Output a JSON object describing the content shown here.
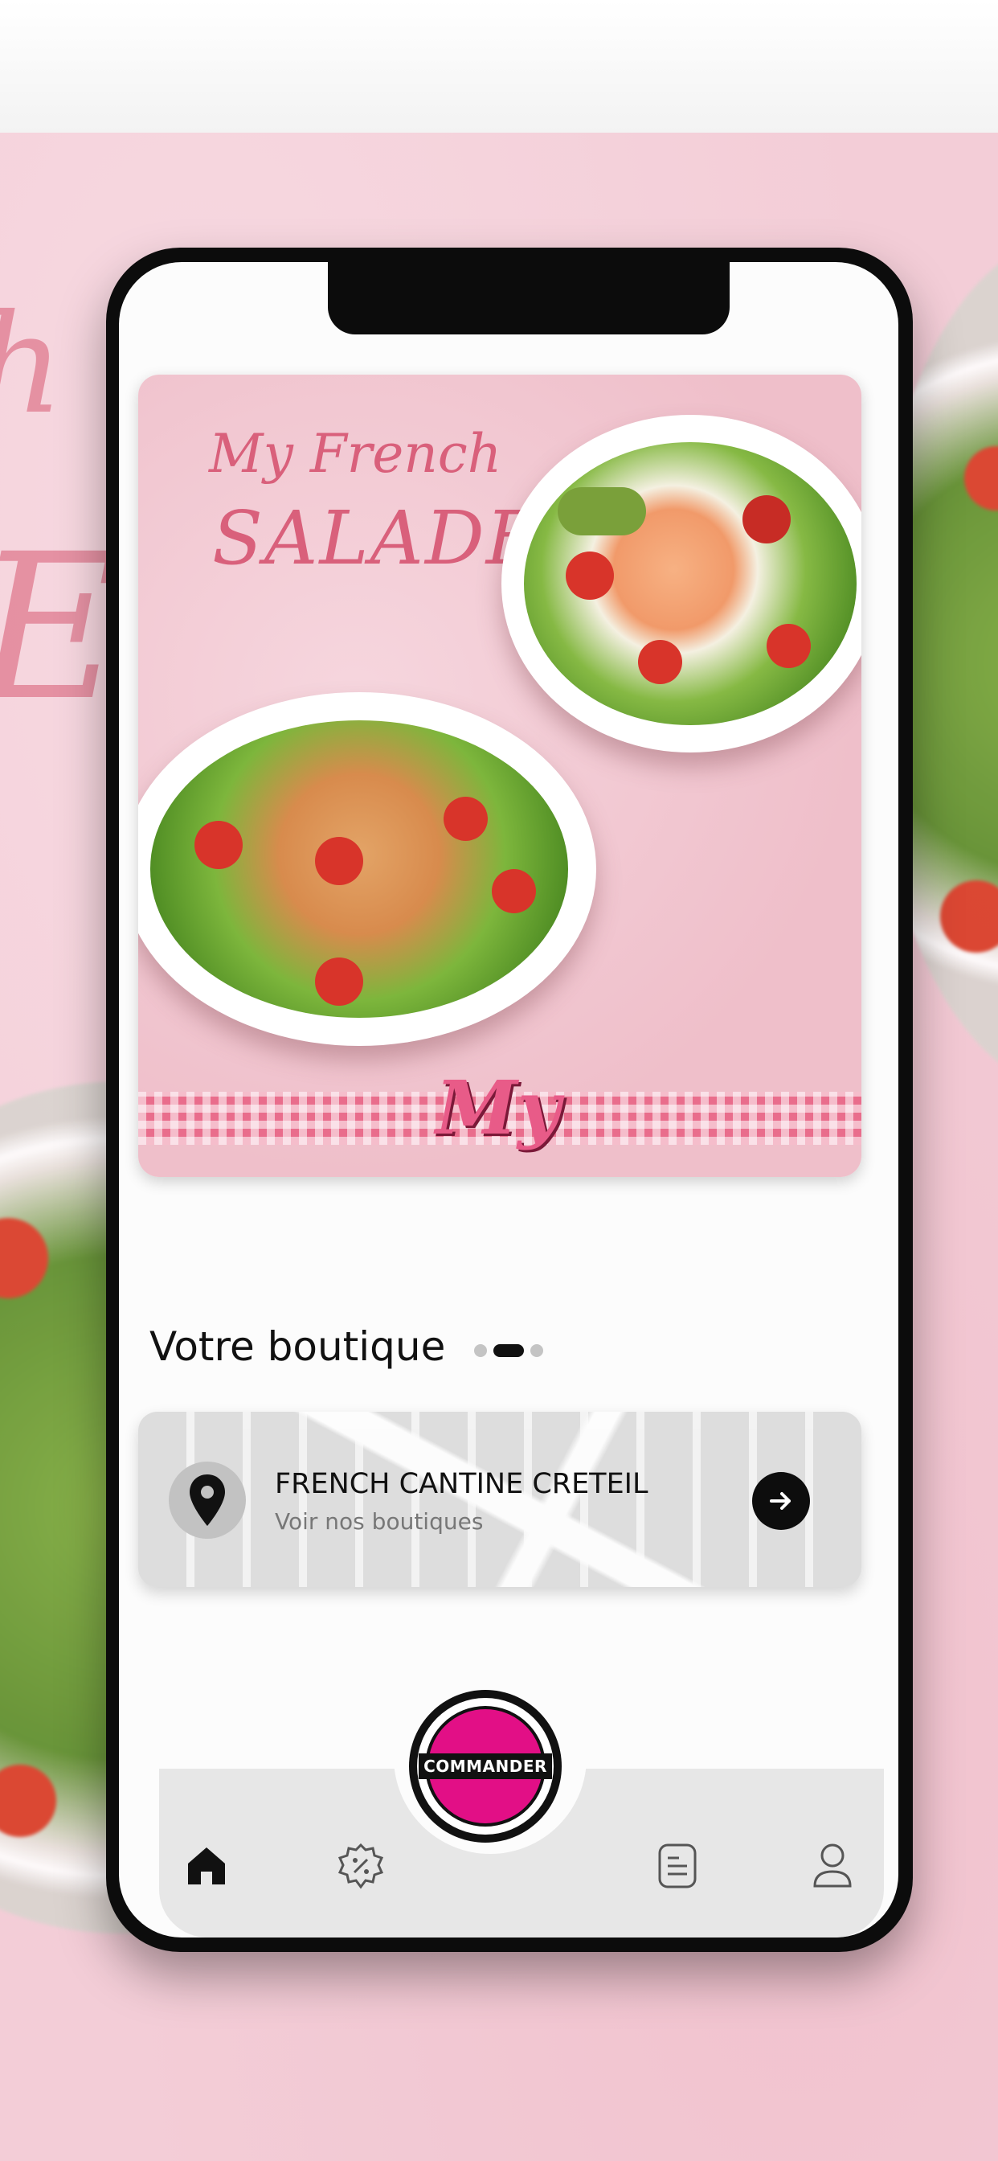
{
  "banner": {
    "title_line1": "My French",
    "title_line2": "SALADE",
    "logo_text": "My"
  },
  "carousel": {
    "page_count": 3,
    "active_index": 1
  },
  "section": {
    "title": "Votre boutique"
  },
  "store": {
    "name": "FRENCH CANTINE CRETEIL",
    "subtitle": "Voir nos boutiques"
  },
  "tabbar": {
    "items": [
      {
        "name": "home",
        "icon": "home-icon",
        "active": true
      },
      {
        "name": "offers",
        "icon": "discount-badge-icon",
        "active": false
      },
      {
        "name": "orders",
        "icon": "document-icon",
        "active": false
      },
      {
        "name": "profile",
        "icon": "user-icon",
        "active": false
      }
    ],
    "order_button_label": "COMMANDER"
  },
  "colors": {
    "accent": "#e20f86",
    "background_pink": "#f3cdd7",
    "tabbar_gray": "#e7e7e7"
  }
}
